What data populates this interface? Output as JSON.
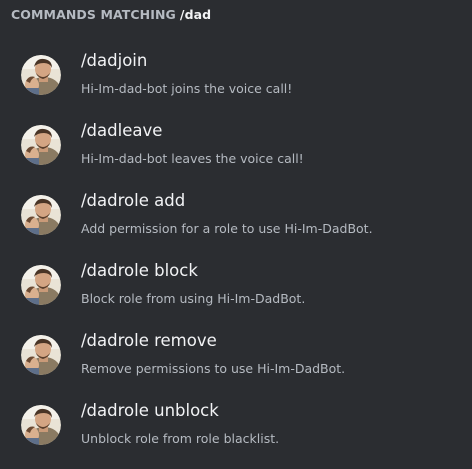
{
  "header": {
    "prefix": "COMMANDS MATCHING",
    "query": "/dad"
  },
  "commands": [
    {
      "name": "/dadjoin",
      "description": "Hi-Im-dad-bot joins the voice call!",
      "icon": "bot-avatar-icon"
    },
    {
      "name": "/dadleave",
      "description": "Hi-Im-dad-bot leaves the voice call!",
      "icon": "bot-avatar-icon"
    },
    {
      "name": "/dadrole add",
      "description": "Add permission for a role to use Hi-Im-DadBot.",
      "icon": "bot-avatar-icon"
    },
    {
      "name": "/dadrole block",
      "description": "Block role from using Hi-Im-DadBot.",
      "icon": "bot-avatar-icon"
    },
    {
      "name": "/dadrole remove",
      "description": "Remove permissions to use Hi-Im-DadBot.",
      "icon": "bot-avatar-icon"
    },
    {
      "name": "/dadrole unblock",
      "description": "Unblock role from role blacklist.",
      "icon": "bot-avatar-icon"
    }
  ],
  "colors": {
    "background": "#2b2d31",
    "header_text": "#b5bac1",
    "command_name": "#f2f3f5",
    "command_description": "#b5bac1"
  }
}
